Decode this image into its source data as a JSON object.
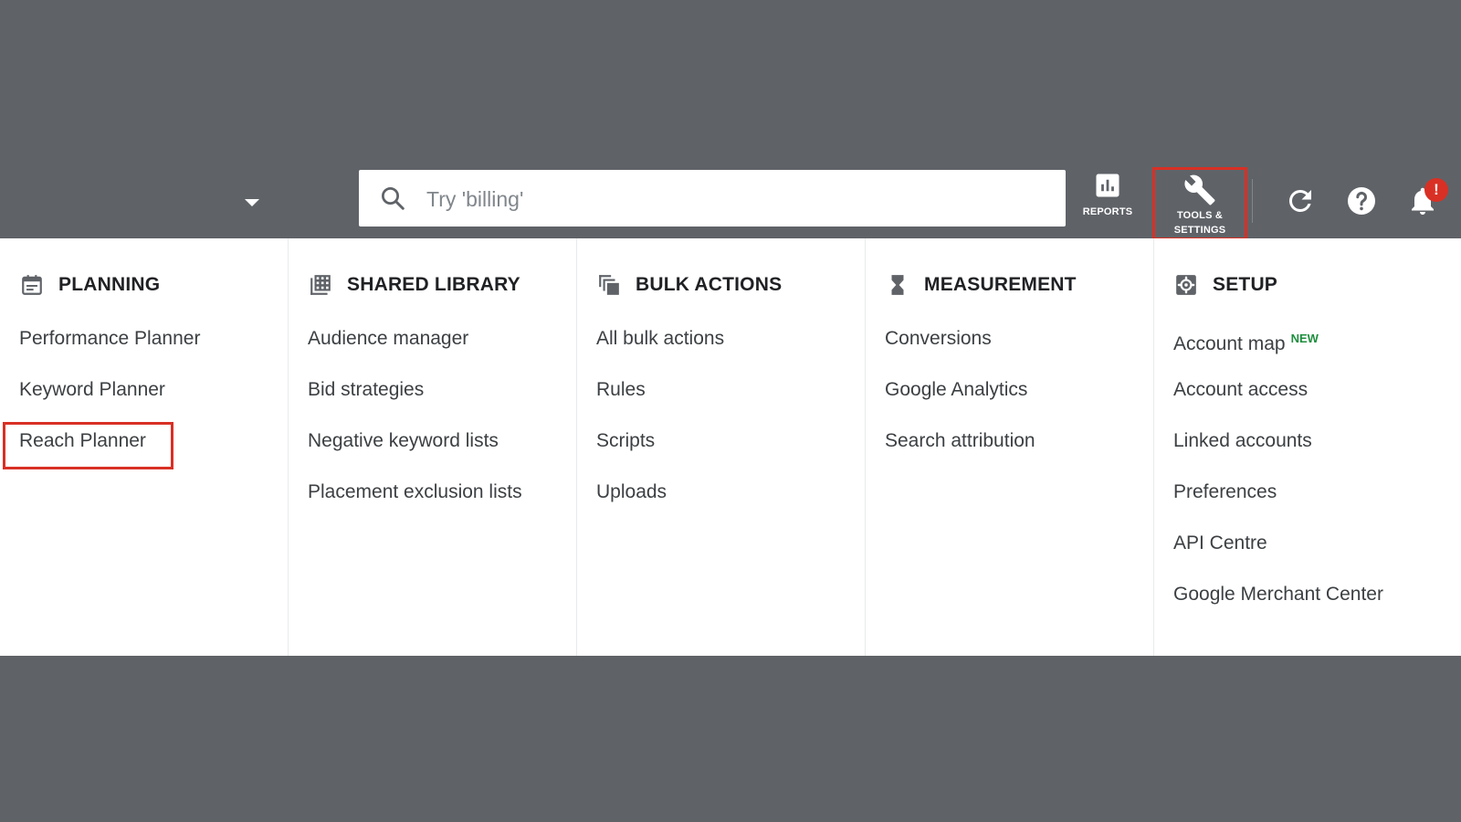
{
  "search": {
    "placeholder": "Try 'billing'"
  },
  "toolbar": {
    "reports_label": "REPORTS",
    "tools_label_line1": "TOOLS &",
    "tools_label_line2": "SETTINGS",
    "notification_badge": "!"
  },
  "colors": {
    "background": "#5f6368",
    "panel": "#ffffff",
    "highlight": "#d93025",
    "new_badge": "#1e8e3e"
  },
  "columns": [
    {
      "title": "PLANNING",
      "icon": "calendar-icon",
      "items": [
        "Performance Planner",
        "Keyword Planner",
        "Reach Planner"
      ]
    },
    {
      "title": "SHARED LIBRARY",
      "icon": "library-grid-icon",
      "items": [
        "Audience manager",
        "Bid strategies",
        "Negative keyword lists",
        "Placement exclusion lists"
      ]
    },
    {
      "title": "BULK ACTIONS",
      "icon": "copy-stack-icon",
      "items": [
        "All bulk actions",
        "Rules",
        "Scripts",
        "Uploads"
      ]
    },
    {
      "title": "MEASUREMENT",
      "icon": "hourglass-icon",
      "items": [
        "Conversions",
        "Google Analytics",
        "Search attribution"
      ]
    },
    {
      "title": "SETUP",
      "icon": "gear-icon",
      "items": [
        "Account map",
        "Account access",
        "Linked accounts",
        "Preferences",
        "API Centre",
        "Google Merchant Center"
      ],
      "new_label": "NEW"
    }
  ]
}
